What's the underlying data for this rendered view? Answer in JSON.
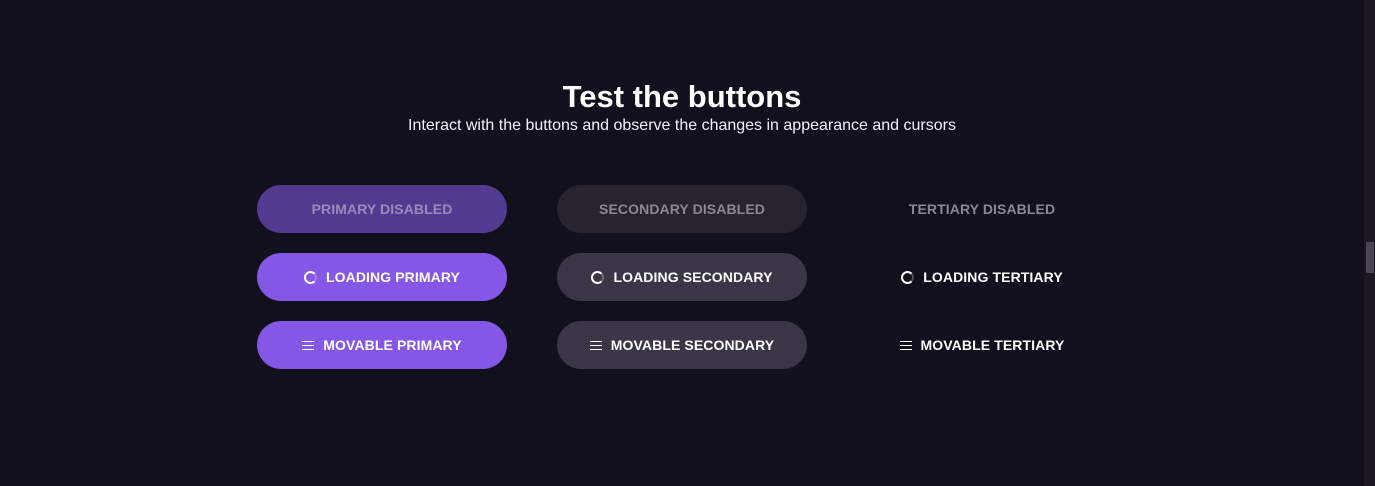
{
  "header": {
    "title": "Test the buttons",
    "subtitle": "Interact with the buttons and observe the changes in appearance and cursors"
  },
  "buttons": {
    "primary_disabled": "PRIMARY DISABLED",
    "secondary_disabled": "SECONDARY DISABLED",
    "tertiary_disabled": "TERTIARY DISABLED",
    "loading_primary": "LOADING PRIMARY",
    "loading_secondary": "LOADING SECONDARY",
    "loading_tertiary": "LOADING TERTIARY",
    "movable_primary": "MOVABLE PRIMARY",
    "movable_secondary": "MOVABLE SECONDARY",
    "movable_tertiary": "MOVABLE TERTIARY"
  },
  "icons": {
    "loading": "spinner-icon",
    "movable": "drag-handle-icon"
  },
  "colors": {
    "background": "#13101e",
    "primary": "#8457e6",
    "primary_disabled": "#533a91",
    "secondary": "#3b3646",
    "secondary_disabled": "#27232f"
  }
}
